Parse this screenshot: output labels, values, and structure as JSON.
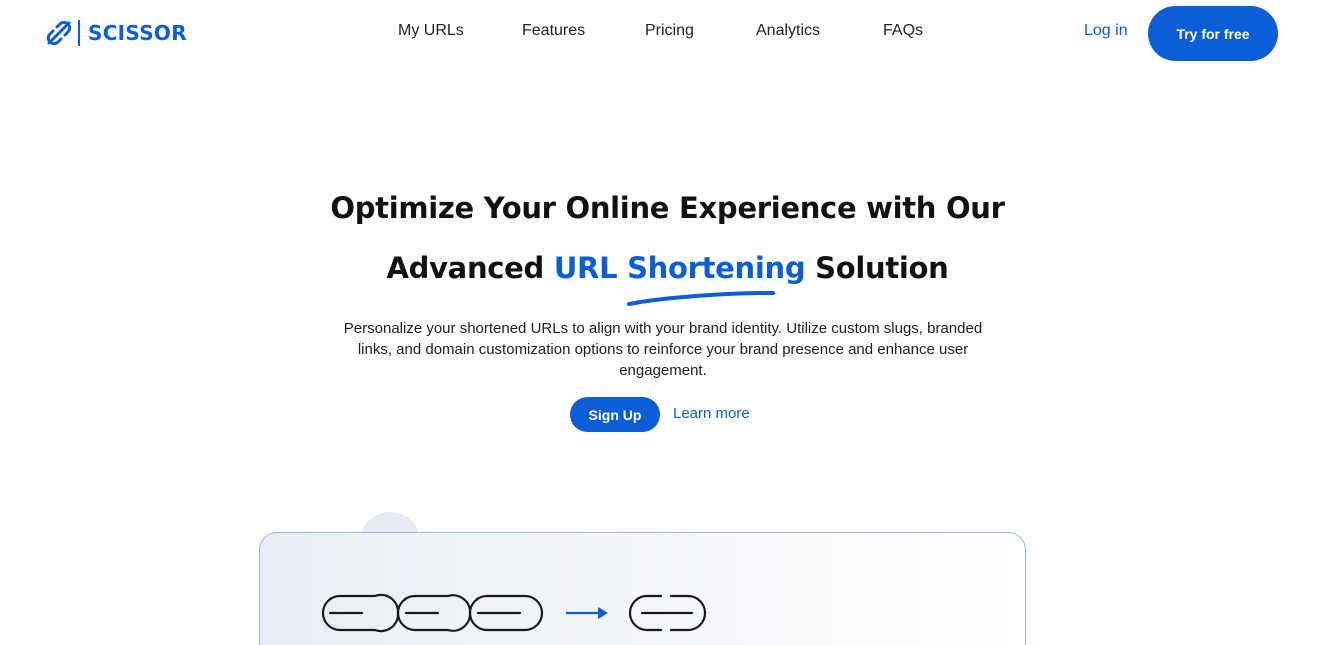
{
  "header": {
    "brand": "SCISSOR",
    "logo_icon": "link-slash-icon",
    "nav": [
      {
        "label": "My URLs"
      },
      {
        "label": "Features"
      },
      {
        "label": "Pricing"
      },
      {
        "label": "Analytics"
      },
      {
        "label": "FAQs"
      }
    ],
    "login_label": "Log in",
    "cta_label": "Try for free"
  },
  "hero": {
    "title_line1": "Optimize Your Online Experience with Our",
    "title_line2_prefix": "Advanced ",
    "title_line2_accent": "URL Shortening",
    "title_line2_suffix": " Solution",
    "description": "Personalize your shortened URLs to align with your brand identity. Utilize custom slugs, branded links, and domain customization options to reinforce your brand presence and enhance user engagement.",
    "signup_label": "Sign Up",
    "learn_more_label": "Learn more"
  },
  "illustration": {
    "long_chain_icon": "chain-link-icon",
    "arrow_icon": "arrow-right-icon",
    "short_chain_icon": "chain-link-icon"
  },
  "colors": {
    "accent": "#0b5ed7",
    "text": "#111111",
    "card_border": "#9ab8e0"
  }
}
